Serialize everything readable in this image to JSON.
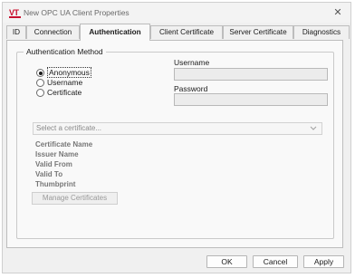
{
  "window": {
    "title": "New OPC UA Client Properties",
    "logo_text": "VT",
    "close_glyph": "✕"
  },
  "tabs": [
    {
      "label": "ID"
    },
    {
      "label": "Connection"
    },
    {
      "label": "Authentication",
      "active": true
    },
    {
      "label": "Client Certificate"
    },
    {
      "label": "Server Certificate"
    },
    {
      "label": "Diagnostics"
    }
  ],
  "auth": {
    "group_title": "Authentication Method",
    "methods": [
      {
        "label": "Anonymous",
        "selected": true
      },
      {
        "label": "Username",
        "selected": false
      },
      {
        "label": "Certificate",
        "selected": false
      }
    ],
    "username_label": "Username",
    "username_value": "",
    "password_label": "Password",
    "password_value": "",
    "certificate_placeholder": "Select a certificate...",
    "cert_info_labels": [
      "Certificate Name",
      "Issuer Name",
      "Valid From",
      "Valid To",
      "Thumbprint"
    ],
    "manage_button": "Manage Certificates"
  },
  "footer": {
    "ok": "OK",
    "cancel": "Cancel",
    "apply": "Apply"
  },
  "icons": {
    "logo": "vt-logo-icon",
    "close": "close-icon",
    "dropdown": "chevron-down-icon"
  },
  "colors": {
    "brand": "#c8102e",
    "dialog_bg": "#f0f0f0",
    "panel_bg": "#f9f9f9"
  }
}
